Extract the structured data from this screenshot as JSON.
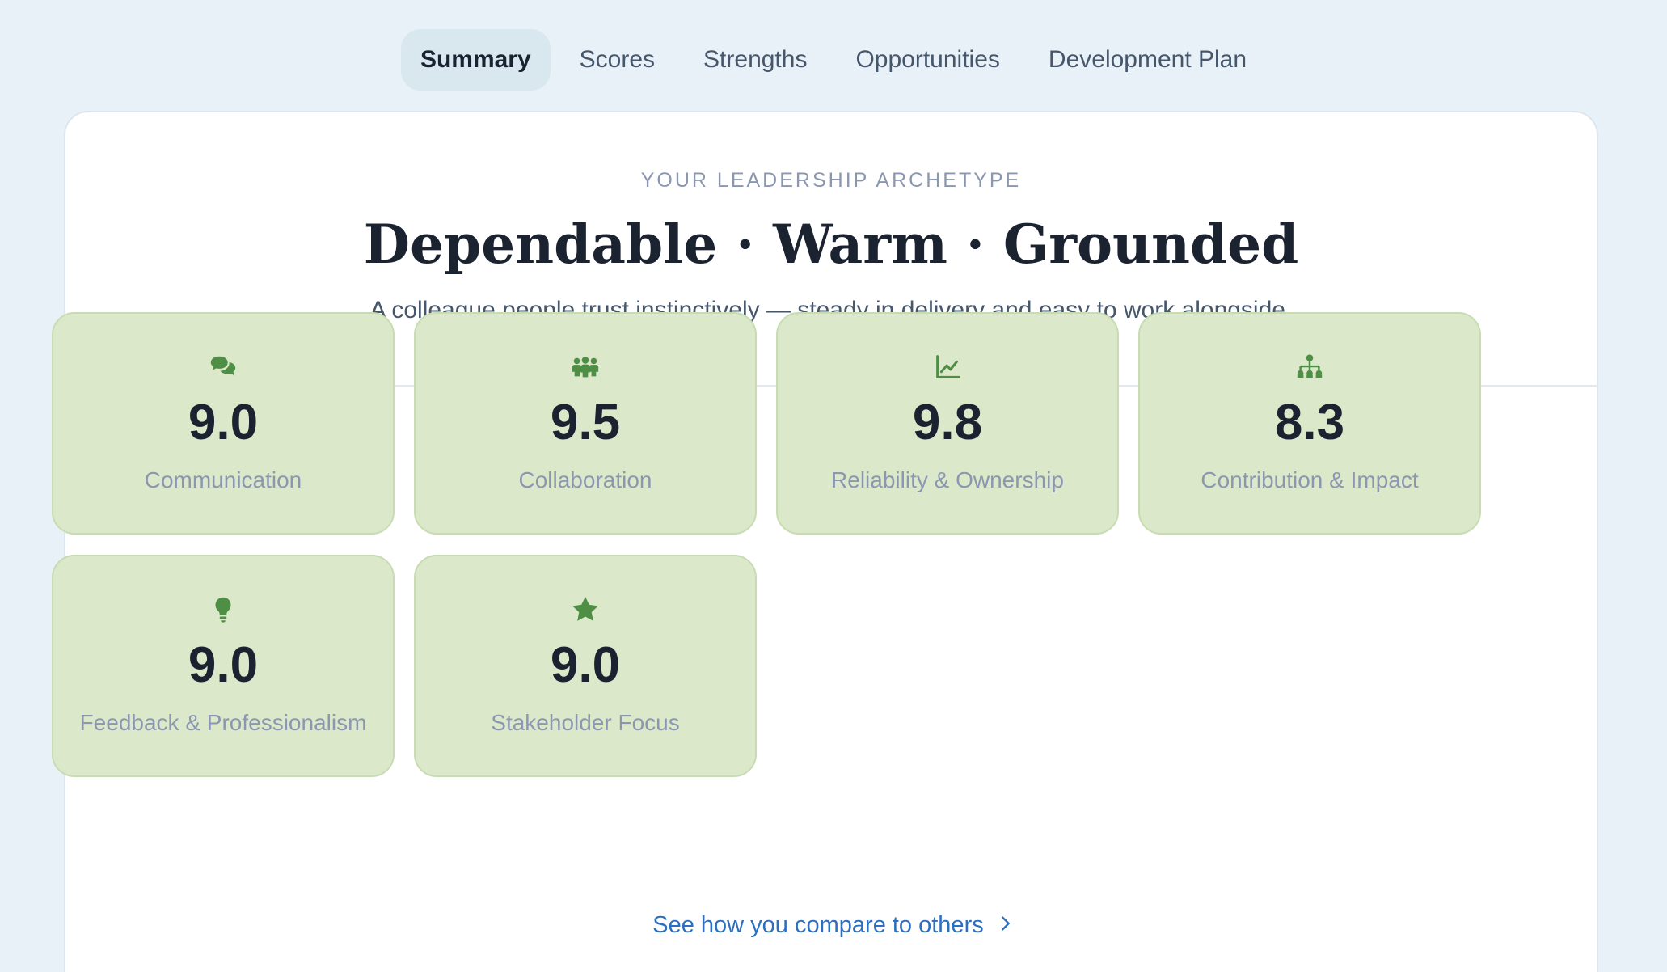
{
  "tabs": [
    {
      "label": "Summary",
      "active": true
    },
    {
      "label": "Scores",
      "active": false
    },
    {
      "label": "Strengths",
      "active": false
    },
    {
      "label": "Opportunities",
      "active": false
    },
    {
      "label": "Development Plan",
      "active": false
    }
  ],
  "hero": {
    "eyebrow": "YOUR LEADERSHIP ARCHETYPE",
    "archetype": "Dependable · Warm · Grounded",
    "tagline": "A colleague people trust instinctively — steady in delivery and easy to work alongside."
  },
  "metrics": [
    {
      "icon": "chat-bubbles-icon",
      "value": "9.0",
      "label": "Communication"
    },
    {
      "icon": "people-group-icon",
      "value": "9.5",
      "label": "Collaboration"
    },
    {
      "icon": "line-chart-icon",
      "value": "9.8",
      "label": "Reliability & Ownership"
    },
    {
      "icon": "org-chart-icon",
      "value": "8.3",
      "label": "Contribution & Impact"
    },
    {
      "icon": "lightbulb-icon",
      "value": "9.0",
      "label": "Feedback & Professionalism"
    },
    {
      "icon": "star-icon",
      "value": "9.0",
      "label": "Stakeholder Focus"
    }
  ],
  "compare_link": {
    "label": "See how you compare to others",
    "icon": "chevron-right-icon"
  },
  "colors": {
    "background": "#e9f1f8",
    "active_tab": "#d9e8ee",
    "metric_card": "#dbe9ca",
    "metric_icon": "#4e8f45",
    "link": "#2d6fbf"
  }
}
